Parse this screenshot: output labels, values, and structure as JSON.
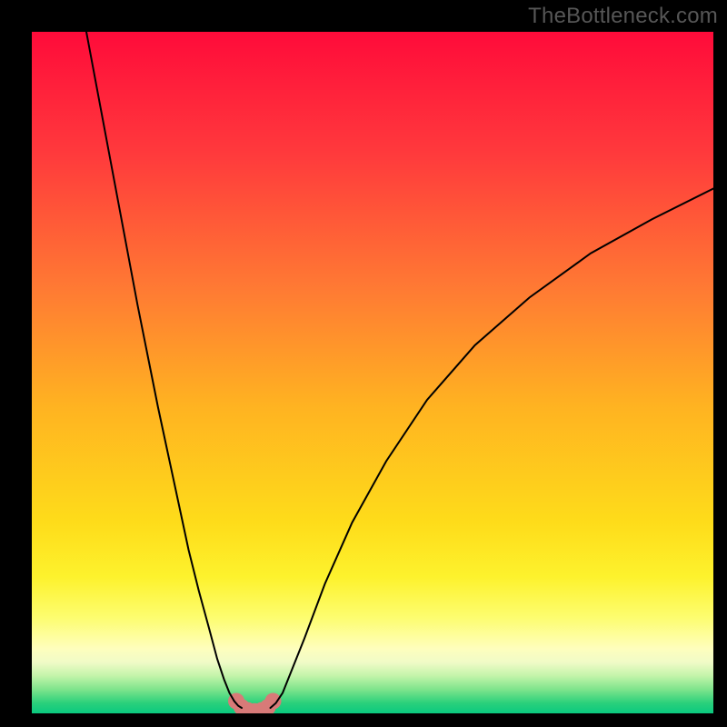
{
  "watermark": "TheBottleneck.com",
  "chart_data": {
    "type": "line",
    "title": "",
    "xlabel": "",
    "ylabel": "",
    "xlim": [
      0,
      100
    ],
    "ylim": [
      0,
      100
    ],
    "background_gradient": {
      "direction": "vertical",
      "stops": [
        {
          "pos": 0.0,
          "color": "#ff0b3a"
        },
        {
          "pos": 0.18,
          "color": "#ff3a3c"
        },
        {
          "pos": 0.38,
          "color": "#ff7b33"
        },
        {
          "pos": 0.55,
          "color": "#ffb321"
        },
        {
          "pos": 0.72,
          "color": "#fedc1a"
        },
        {
          "pos": 0.8,
          "color": "#fdf22d"
        },
        {
          "pos": 0.86,
          "color": "#fdfd70"
        },
        {
          "pos": 0.905,
          "color": "#fefebd"
        },
        {
          "pos": 0.925,
          "color": "#f0fbc7"
        },
        {
          "pos": 0.945,
          "color": "#c3f4a9"
        },
        {
          "pos": 0.965,
          "color": "#7ee48c"
        },
        {
          "pos": 0.985,
          "color": "#2ad07b"
        },
        {
          "pos": 1.0,
          "color": "#0ac97f"
        }
      ]
    },
    "series": [
      {
        "name": "left-curve",
        "color": "#000000",
        "stroke_width": 2,
        "x": [
          8.0,
          9.5,
          11.0,
          12.5,
          14.0,
          15.5,
          17.0,
          18.5,
          20.0,
          21.5,
          23.0,
          24.5,
          26.0,
          27.2,
          28.2,
          29.0,
          29.7,
          30.3,
          30.8
        ],
        "y": [
          100.0,
          92.0,
          84.0,
          76.0,
          68.0,
          60.0,
          52.5,
          45.0,
          38.0,
          31.0,
          24.0,
          18.0,
          12.5,
          8.0,
          5.0,
          3.0,
          1.8,
          1.1,
          0.8
        ]
      },
      {
        "name": "right-curve",
        "color": "#000000",
        "stroke_width": 2,
        "x": [
          35.0,
          35.8,
          36.8,
          38.0,
          40.0,
          43.0,
          47.0,
          52.0,
          58.0,
          65.0,
          73.0,
          82.0,
          91.0,
          100.0
        ],
        "y": [
          0.8,
          1.5,
          3.0,
          6.0,
          11.0,
          19.0,
          28.0,
          37.0,
          46.0,
          54.0,
          61.0,
          67.5,
          72.5,
          77.0
        ]
      },
      {
        "name": "bottom-dots",
        "type": "scatter",
        "color": "#d87a78",
        "marker_radius": 9,
        "x": [
          30.0,
          30.8,
          31.7,
          32.7,
          33.7,
          34.6,
          35.4
        ],
        "y": [
          1.8,
          0.9,
          0.45,
          0.3,
          0.45,
          0.9,
          1.8
        ]
      },
      {
        "name": "bottom-connector",
        "color": "#d87a78",
        "stroke_width": 11,
        "x": [
          30.0,
          30.8,
          31.7,
          32.7,
          33.7,
          34.6,
          35.4
        ],
        "y": [
          1.8,
          0.9,
          0.45,
          0.3,
          0.45,
          0.9,
          1.8
        ]
      }
    ]
  }
}
